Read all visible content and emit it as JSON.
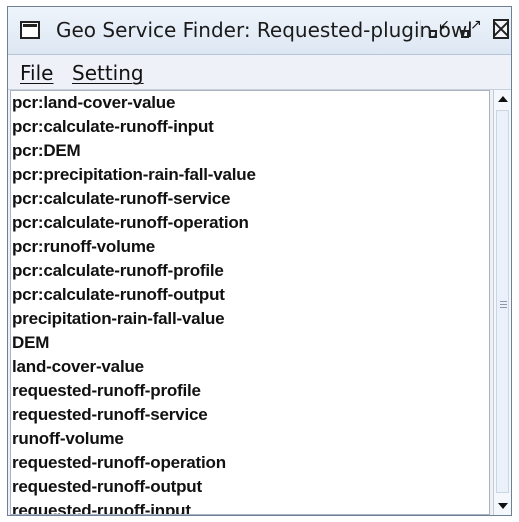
{
  "window": {
    "title": "Geo Service Finder: Requested-plugin.owl",
    "controls": {
      "minimize_icon": "minimize-icon",
      "maximize_icon": "maximize-icon",
      "close_icon": "close-icon"
    }
  },
  "menu": {
    "file": "File",
    "setting": "Setting"
  },
  "list": [
    "pcr:land-cover-value",
    "pcr:calculate-runoff-input",
    "pcr:DEM",
    "pcr:precipitation-rain-fall-value",
    "pcr:calculate-runoff-service",
    "pcr:calculate-runoff-operation",
    "pcr:runoff-volume",
    "pcr:calculate-runoff-profile",
    "pcr:calculate-runoff-output",
    "precipitation-rain-fall-value",
    "DEM",
    "land-cover-value",
    "requested-runoff-profile",
    "requested-runoff-service",
    "runoff-volume",
    "requested-runoff-operation",
    "requested-runoff-output",
    "requested-runoff-input"
  ]
}
